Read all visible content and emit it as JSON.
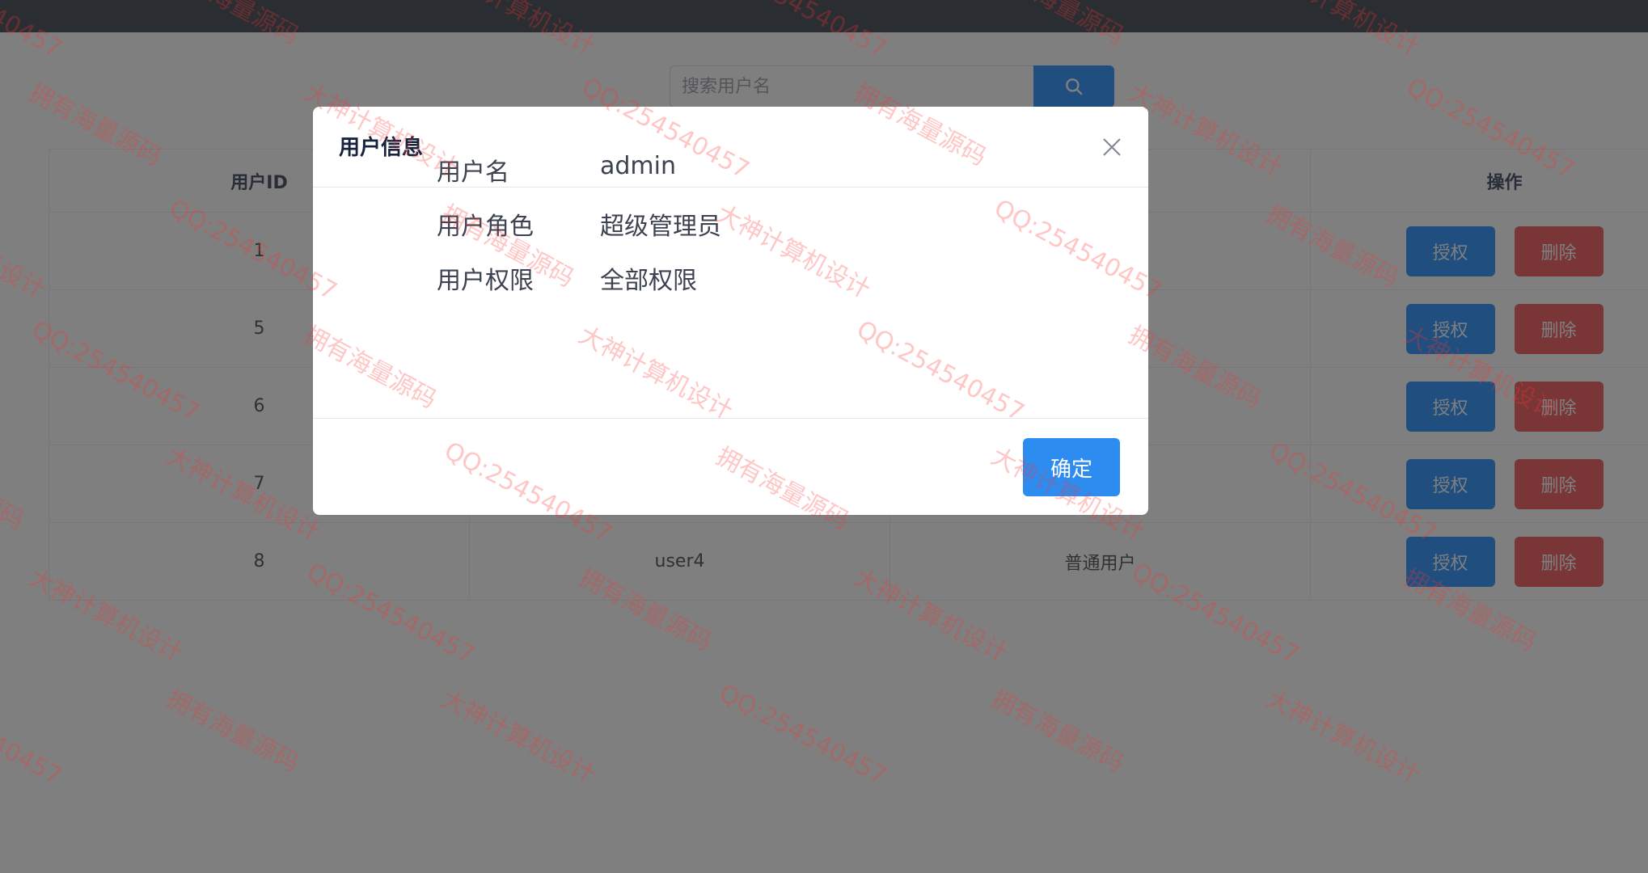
{
  "search": {
    "placeholder": "搜索用户名"
  },
  "table": {
    "headers": [
      "用户ID",
      "",
      "",
      "操作"
    ],
    "rows": [
      {
        "id": "1",
        "username": "",
        "role": ""
      },
      {
        "id": "5",
        "username": "",
        "role": ""
      },
      {
        "id": "6",
        "username": "",
        "role": ""
      },
      {
        "id": "7",
        "username": "",
        "role": ""
      },
      {
        "id": "8",
        "username": "user4",
        "role": "普通用户"
      }
    ],
    "auth_label": "授权",
    "delete_label": "删除"
  },
  "dialog": {
    "title": "用户信息",
    "fields": [
      {
        "label": "用户名",
        "value": "admin"
      },
      {
        "label": "用户角色",
        "value": "超级管理员"
      },
      {
        "label": "用户权限",
        "value": "全部权限"
      }
    ],
    "confirm_label": "确定"
  },
  "watermark": {
    "texts": [
      "QQ:254540457",
      "拥有海量源码",
      "大神计算机设计"
    ]
  },
  "colors": {
    "primary": "#409eff",
    "danger": "#f56c6c",
    "confirm": "#2d8cf0",
    "topbar": "#545c64",
    "watermark": "#ff3232"
  }
}
